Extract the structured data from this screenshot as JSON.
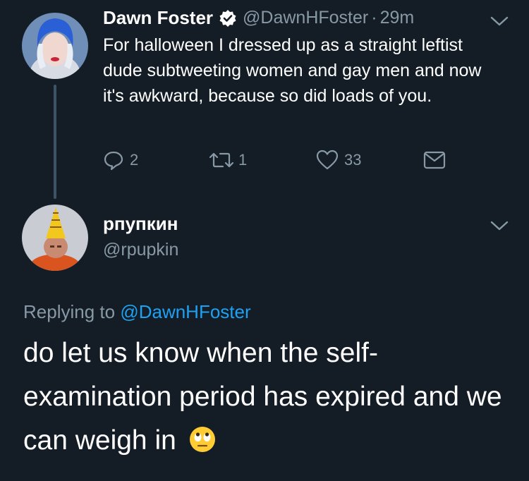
{
  "tweet1": {
    "name": "Dawn Foster",
    "handle": "@DawnHFoster",
    "separator": "·",
    "time": "29m",
    "text": "For halloween I dressed up as a straight leftist dude subtweeting women and gay men and now it's awkward, because so did loads of you.",
    "replies": "2",
    "retweets": "1",
    "likes": "33"
  },
  "tweet2": {
    "name": "рпупкин",
    "handle": "@rpupkin",
    "replying_prefix": "Replying to",
    "replying_to": "@DawnHFoster",
    "text": "do let us know when the self-examination period has expired and we can weigh in"
  },
  "colors": {
    "background": "#141d26",
    "muted": "#8899a6",
    "link": "#1da1f2",
    "thread_line": "#3d5466"
  },
  "icons": [
    "verified-icon",
    "chevron-down-icon",
    "reply-icon",
    "retweet-icon",
    "heart-icon",
    "direct-message-icon",
    "eye-roll-emoji"
  ]
}
